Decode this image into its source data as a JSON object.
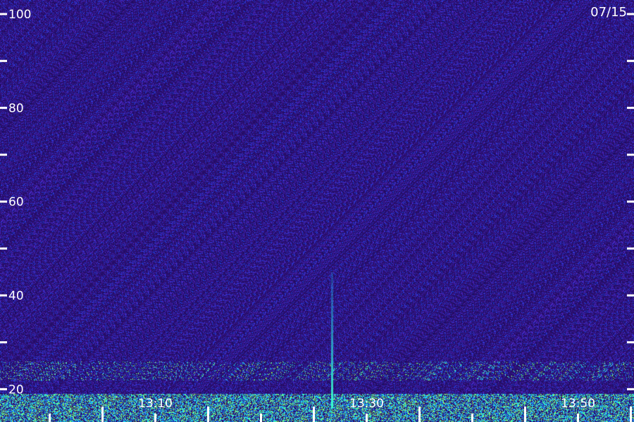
{
  "chart_data": {
    "type": "heatmap",
    "date_label": "07/15",
    "y_axis": {
      "min": 13,
      "max": 103,
      "major_ticks": [
        20,
        40,
        60,
        80,
        100
      ],
      "tick_labels": [
        "20",
        "40",
        "60",
        "80",
        "100"
      ],
      "minor_ticks": [
        10,
        30,
        50,
        70,
        90
      ]
    },
    "x_axis": {
      "start_minute": 0,
      "end_minute": 60,
      "label_times": [
        {
          "minute": 14.7,
          "label": "13:10"
        },
        {
          "minute": 34.7,
          "label": "13:30"
        },
        {
          "minute": 54.7,
          "label": "13:50"
        }
      ],
      "major_tick_minutes": [
        9.7,
        19.7,
        29.7,
        39.7,
        49.7,
        59.7
      ],
      "minor_tick_minutes": [
        4.7,
        14.7,
        24.7,
        34.7,
        44.7,
        54.7
      ]
    },
    "background_color": "#2a0f6e",
    "noise_colors": [
      "#1a0a5a",
      "#3a1a9a",
      "#4a2acb",
      "#1e3cd8"
    ],
    "signal_colors": [
      "#1f6cff",
      "#18c8ff",
      "#3dffb0",
      "#9bff5a"
    ],
    "features": {
      "spike": {
        "minute": 31.4,
        "from": 16,
        "to": 45
      },
      "noise_bands": [
        {
          "from": 13,
          "to": 19,
          "strength": "strong"
        },
        {
          "from": 22,
          "to": 26,
          "strength": "medium"
        }
      ]
    }
  }
}
